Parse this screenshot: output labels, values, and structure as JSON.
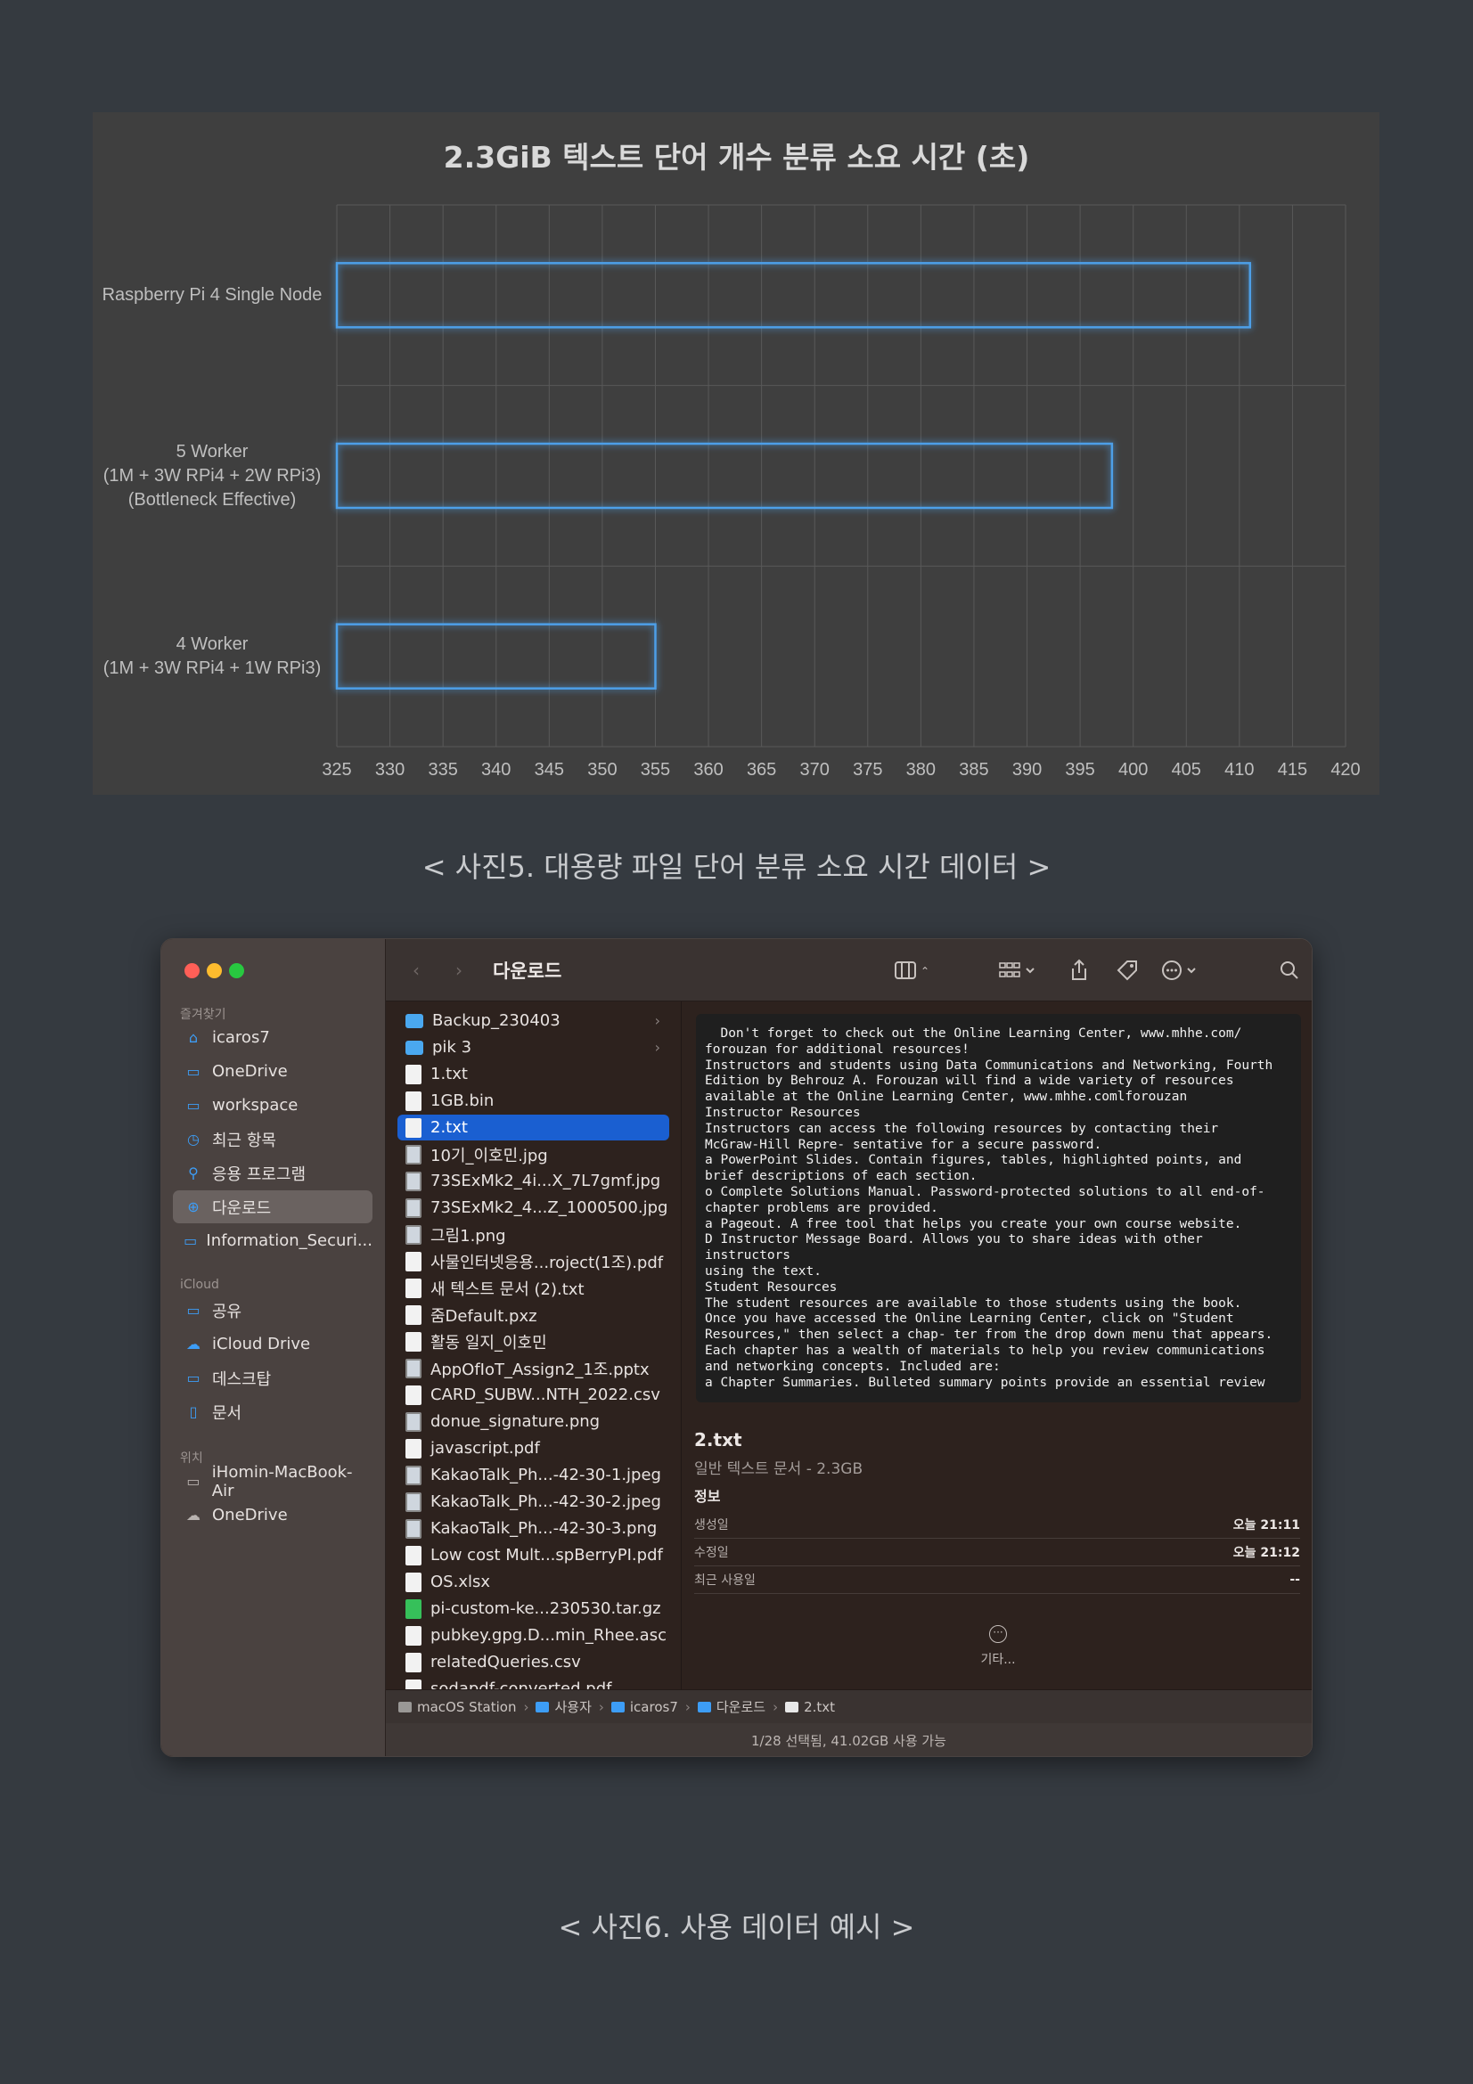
{
  "chart_data": {
    "type": "bar",
    "orientation": "horizontal",
    "title": "2.3GiB 텍스트 단어 개수 분류 소요 시간 (초)",
    "categories": [
      "Raspberry Pi 4 Single Node",
      "5 Worker\n(1M + 3W RPi4 + 2W RPi3)\n(Bottleneck Effective)",
      "4 Worker\n(1M + 3W RPi4 + 1W RPi3)"
    ],
    "values": [
      411,
      398,
      355
    ],
    "xlim": [
      325,
      420
    ],
    "xticks": [
      "325",
      "330",
      "335",
      "340",
      "345",
      "350",
      "355",
      "360",
      "365",
      "370",
      "375",
      "380",
      "385",
      "390",
      "395",
      "400",
      "405",
      "410",
      "415",
      "420"
    ],
    "grid": true,
    "colors": {
      "bar_outline": "#4d9fe8",
      "background": "#3f3f3f",
      "grid": "#595959"
    }
  },
  "captions": {
    "chart": "< 사진5. 대용량 파일 단어 분류 소요 시간 데이터 >",
    "finder": "< 사진6. 사용 데이터 예시 >"
  },
  "finder": {
    "title": "다운로드",
    "sidebar": {
      "favorites_label": "즐겨찾기",
      "favorites": [
        {
          "label": "icaros7",
          "icon": "house-icon"
        },
        {
          "label": "OneDrive",
          "icon": "folder-icon"
        },
        {
          "label": "workspace",
          "icon": "folder-icon"
        },
        {
          "label": "최근 항목",
          "icon": "clock-icon"
        },
        {
          "label": "응용 프로그램",
          "icon": "apps-icon"
        },
        {
          "label": "다운로드",
          "icon": "download-icon",
          "active": true
        },
        {
          "label": "Information_Securi...",
          "icon": "folder-icon"
        }
      ],
      "icloud_label": "iCloud",
      "icloud": [
        {
          "label": "공유",
          "icon": "shared-folder-icon"
        },
        {
          "label": "iCloud Drive",
          "icon": "cloud-icon"
        },
        {
          "label": "데스크탑",
          "icon": "desktop-icon"
        },
        {
          "label": "문서",
          "icon": "document-icon"
        }
      ],
      "locations_label": "위치",
      "locations": [
        {
          "label": "iHomin-MacBook-Air",
          "icon": "laptop-icon"
        },
        {
          "label": "OneDrive",
          "icon": "cloud-icon"
        }
      ]
    },
    "files": [
      {
        "name": "Backup_230403",
        "type": "folder"
      },
      {
        "name": "pik 3",
        "type": "folder"
      },
      {
        "name": "1.txt",
        "type": "doc"
      },
      {
        "name": "1GB.bin",
        "type": "doc"
      },
      {
        "name": "2.txt",
        "type": "doc",
        "selected": true
      },
      {
        "name": "10기_이호민.jpg",
        "type": "img"
      },
      {
        "name": "73SExMk2_4i...X_7L7gmf.jpg",
        "type": "img"
      },
      {
        "name": "73SExMk2_4...Z_1000500.jpg",
        "type": "img"
      },
      {
        "name": "그림1.png",
        "type": "img"
      },
      {
        "name": "사물인터넷응용...roject(1조).pdf",
        "type": "doc"
      },
      {
        "name": "새 텍스트 문서 (2).txt",
        "type": "doc"
      },
      {
        "name": "줌Default.pxz",
        "type": "doc"
      },
      {
        "name": "활동 일지_이호민",
        "type": "doc"
      },
      {
        "name": "AppOfIoT_Assign2_1조.pptx",
        "type": "img"
      },
      {
        "name": "CARD_SUBW...NTH_2022.csv",
        "type": "doc"
      },
      {
        "name": "donue_signature.png",
        "type": "img"
      },
      {
        "name": "javascript.pdf",
        "type": "doc"
      },
      {
        "name": "KakaoTalk_Ph...-42-30-1.jpeg",
        "type": "img"
      },
      {
        "name": "KakaoTalk_Ph...-42-30-2.jpeg",
        "type": "img"
      },
      {
        "name": "KakaoTalk_Ph...-42-30-3.png",
        "type": "img"
      },
      {
        "name": "Low cost Mult...spBerryPI.pdf",
        "type": "doc"
      },
      {
        "name": "OS.xlsx",
        "type": "doc"
      },
      {
        "name": "pi-custom-ke...230530.tar.gz",
        "type": "green"
      },
      {
        "name": "pubkey.gpg.D...min_Rhee.asc",
        "type": "doc"
      },
      {
        "name": "relatedQueries.csv",
        "type": "doc"
      },
      {
        "name": "sodapdf-converted.pdf",
        "type": "doc"
      }
    ],
    "preview": {
      "text": "  Don't forget to check out the Online Learning Center, www.mhhe.com/\nforouzan for additional resources!\nInstructors and students using Data Communications and Networking, Fourth\nEdition by Behrouz A. Forouzan will find a wide variety of resources\navailable at the Online Learning Center, www.mhhe.comlforouzan\nInstructor Resources\nInstructors can access the following resources by contacting their\nMcGraw-Hill Repre- sentative for a secure password.\na PowerPoint Slides. Contain figures, tables, highlighted points, and\nbrief descriptions of each section.\no Complete Solutions Manual. Password-protected solutions to all end-of-\nchapter problems are provided.\na Pageout. A free tool that helps you create your own course website.\nD Instructor Message Board. Allows you to share ideas with other\ninstructors\nusing the text.\nStudent Resources\nThe student resources are available to those students using the book.\nOnce you have accessed the Online Learning Center, click on \"Student\nResources,\" then select a chap- ter from the drop down menu that appears.\nEach chapter has a wealth of materials to help you review communications\nand networking concepts. Included are:\na Chapter Summaries. Bulleted summary points provide an essential review",
      "name": "2.txt",
      "kind": "일반 텍스트 문서 - 2.3GB",
      "info_label": "정보",
      "info": [
        {
          "label": "생성일",
          "value": "오늘 21:11"
        },
        {
          "label": "수정일",
          "value": "오늘 21:12"
        },
        {
          "label": "최근 사용일",
          "value": "--"
        }
      ],
      "more_label": "기타..."
    },
    "path": [
      "macOS Station",
      "사용자",
      "icaros7",
      "다운로드",
      "2.txt"
    ],
    "status": "1/28 선택됨, 41.02GB 사용 가능"
  }
}
